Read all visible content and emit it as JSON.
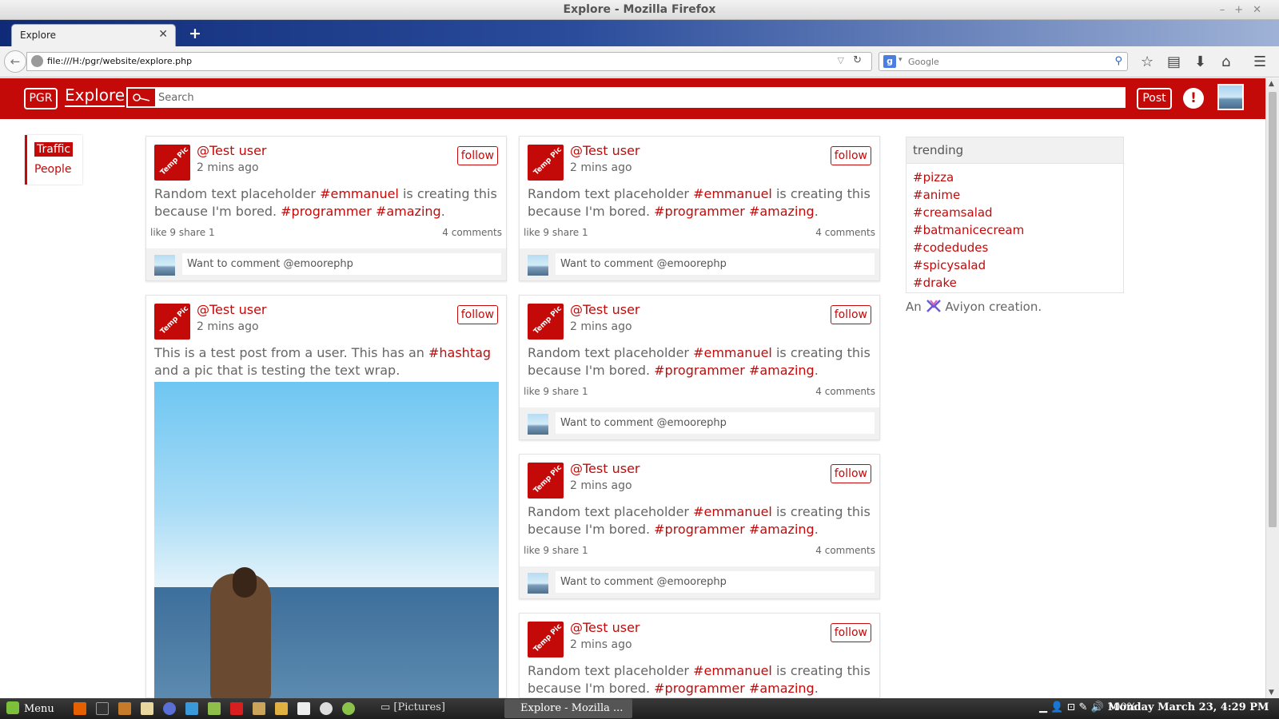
{
  "window": {
    "title": "Explore - Mozilla Firefox"
  },
  "browser": {
    "tab_label": "Explore",
    "url": "file:///H:/pgr/website/explore.php",
    "search_engine_placeholder": "Google"
  },
  "header": {
    "logo": "PGR",
    "nav_label": "Explore",
    "search_placeholder": "Search",
    "post_label": "Post",
    "alert_icon": "!"
  },
  "filter": {
    "active": "Traffic",
    "items": [
      "People"
    ]
  },
  "posts": [
    {
      "user": "@Test user",
      "time": "2 mins ago",
      "follow": "follow",
      "text_parts": [
        "Random text placeholder ",
        "#emmanuel",
        " is creating this because I'm bored. ",
        "#programmer",
        " ",
        "#amazing",
        "."
      ],
      "likes": "like 9",
      "shares": "share 1",
      "comments": "4 comments",
      "comment_placeholder": "Want to comment @emoorephp"
    },
    {
      "user": "@Test user",
      "time": "2 mins ago",
      "follow": "follow",
      "text_parts": [
        "This is a test post from a user. This has an ",
        "#hashtag",
        " and a pic that is testing the text wrap."
      ]
    },
    {
      "user": "@Test user",
      "time": "2 mins ago",
      "follow": "follow",
      "text_parts": [
        "Random text placeholder ",
        "#emmanuel",
        " is creating this because I'm bored. ",
        "#programmer",
        " ",
        "#amazing",
        "."
      ],
      "likes": "like 9",
      "shares": "share 1",
      "comments": "4 comments",
      "comment_placeholder": "Want to comment @emoorephp"
    },
    {
      "user": "@Test user",
      "time": "2 mins ago",
      "follow": "follow",
      "text_parts": [
        "Random text placeholder ",
        "#emmanuel",
        " is creating this because I'm bored. ",
        "#programmer",
        " ",
        "#amazing",
        "."
      ],
      "likes": "like 9",
      "shares": "share 1",
      "comments": "4 comments",
      "comment_placeholder": "Want to comment @emoorephp"
    },
    {
      "user": "@Test user",
      "time": "2 mins ago",
      "follow": "follow",
      "text_parts": [
        "Random text placeholder ",
        "#emmanuel",
        " is creating this because I'm bored. ",
        "#programmer",
        " ",
        "#amazing",
        "."
      ],
      "likes": "like 9",
      "shares": "share 1",
      "comments": "4 comments",
      "comment_placeholder": "Want to comment @emoorephp"
    },
    {
      "user": "@Test user",
      "time": "2 mins ago",
      "follow": "follow",
      "text_parts": [
        "Random text placeholder ",
        "#emmanuel",
        " is creating this because I'm bored. ",
        "#programmer",
        " ",
        "#amazing",
        "."
      ]
    }
  ],
  "avatar_label": "Temp Pic",
  "trending": {
    "title": "trending",
    "tags": [
      "#pizza",
      "#anime",
      "#creamsalad",
      "#batmanicecream",
      "#codedudes",
      "#spicysalad",
      "#drake"
    ]
  },
  "credit": {
    "before": "An",
    "after": "Aviyon creation."
  },
  "taskbar": {
    "menu": "Menu",
    "window_1": "[Pictures]",
    "window_2": "Explore - Mozilla ...",
    "battery": "100%",
    "clock": "Monday March 23,  4:29 PM"
  },
  "colors": {
    "brand": "#c40909",
    "text": "#666666"
  }
}
